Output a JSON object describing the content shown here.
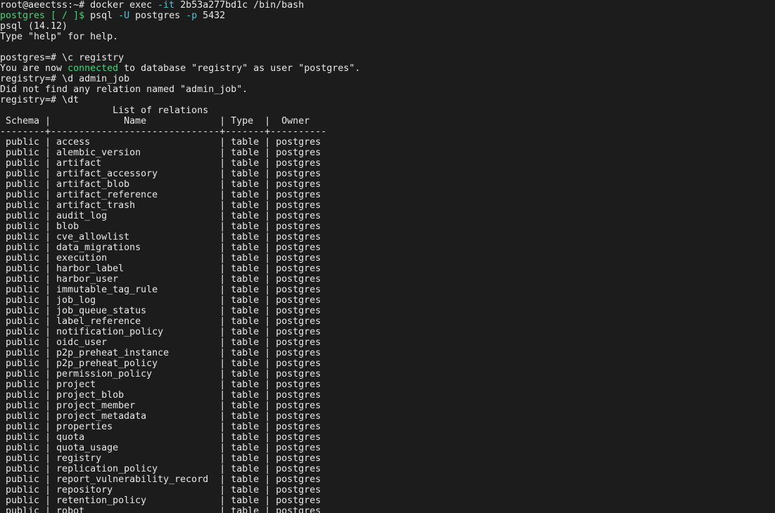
{
  "terminal": {
    "background_color": "#1c1c1c",
    "foreground_color": "#e8e8e8",
    "green_color": "#3fd67a",
    "cyan_color": "#4fc3d9",
    "shell_prompt_host": "root@aeectss:~#",
    "docker_prompt": "postgres [ / ]$",
    "psql_prompt_postgres": "postgres=#",
    "psql_prompt_registry": "registry=#"
  },
  "session": {
    "line_01_prompt": "root@aeectss:~# docker exec ",
    "line_01_flag": "-it",
    "line_01_rest": " 2b53a277bd1c /bin/bash",
    "line_02_prompt": "postgres [ / ]$",
    "line_02_cmd": " psql ",
    "line_02_flag_u": "-U",
    "line_02_user": " postgres ",
    "line_02_flag_p": "-p",
    "line_02_port": " 5432",
    "line_03": "psql (14.12)",
    "line_04": "Type \"help\" for help.",
    "line_05": "",
    "line_06": "postgres=# \\c registry",
    "line_07_a": "You are now ",
    "line_07_b": "connected",
    "line_07_c": " to database \"registry\" as user \"postgres\".",
    "line_08": "registry=# \\d admin_job",
    "line_09": "Did not find any relation named \"admin_job\".",
    "line_10": "registry=# \\dt"
  },
  "relations_table": {
    "title": "List of relations",
    "title_indent": 20,
    "header": " Schema |             Name             | Type  |  Owner   ",
    "separator": "--------+------------------------------+-------+----------",
    "columns": [
      "Schema",
      "Name",
      "Type",
      "Owner"
    ],
    "rows": [
      {
        "schema": "public",
        "name": "access",
        "type": "table",
        "owner": "postgres"
      },
      {
        "schema": "public",
        "name": "alembic_version",
        "type": "table",
        "owner": "postgres"
      },
      {
        "schema": "public",
        "name": "artifact",
        "type": "table",
        "owner": "postgres"
      },
      {
        "schema": "public",
        "name": "artifact_accessory",
        "type": "table",
        "owner": "postgres"
      },
      {
        "schema": "public",
        "name": "artifact_blob",
        "type": "table",
        "owner": "postgres"
      },
      {
        "schema": "public",
        "name": "artifact_reference",
        "type": "table",
        "owner": "postgres"
      },
      {
        "schema": "public",
        "name": "artifact_trash",
        "type": "table",
        "owner": "postgres"
      },
      {
        "schema": "public",
        "name": "audit_log",
        "type": "table",
        "owner": "postgres"
      },
      {
        "schema": "public",
        "name": "blob",
        "type": "table",
        "owner": "postgres"
      },
      {
        "schema": "public",
        "name": "cve_allowlist",
        "type": "table",
        "owner": "postgres"
      },
      {
        "schema": "public",
        "name": "data_migrations",
        "type": "table",
        "owner": "postgres"
      },
      {
        "schema": "public",
        "name": "execution",
        "type": "table",
        "owner": "postgres"
      },
      {
        "schema": "public",
        "name": "harbor_label",
        "type": "table",
        "owner": "postgres"
      },
      {
        "schema": "public",
        "name": "harbor_user",
        "type": "table",
        "owner": "postgres"
      },
      {
        "schema": "public",
        "name": "immutable_tag_rule",
        "type": "table",
        "owner": "postgres"
      },
      {
        "schema": "public",
        "name": "job_log",
        "type": "table",
        "owner": "postgres"
      },
      {
        "schema": "public",
        "name": "job_queue_status",
        "type": "table",
        "owner": "postgres"
      },
      {
        "schema": "public",
        "name": "label_reference",
        "type": "table",
        "owner": "postgres"
      },
      {
        "schema": "public",
        "name": "notification_policy",
        "type": "table",
        "owner": "postgres"
      },
      {
        "schema": "public",
        "name": "oidc_user",
        "type": "table",
        "owner": "postgres"
      },
      {
        "schema": "public",
        "name": "p2p_preheat_instance",
        "type": "table",
        "owner": "postgres"
      },
      {
        "schema": "public",
        "name": "p2p_preheat_policy",
        "type": "table",
        "owner": "postgres"
      },
      {
        "schema": "public",
        "name": "permission_policy",
        "type": "table",
        "owner": "postgres"
      },
      {
        "schema": "public",
        "name": "project",
        "type": "table",
        "owner": "postgres"
      },
      {
        "schema": "public",
        "name": "project_blob",
        "type": "table",
        "owner": "postgres"
      },
      {
        "schema": "public",
        "name": "project_member",
        "type": "table",
        "owner": "postgres"
      },
      {
        "schema": "public",
        "name": "project_metadata",
        "type": "table",
        "owner": "postgres"
      },
      {
        "schema": "public",
        "name": "properties",
        "type": "table",
        "owner": "postgres"
      },
      {
        "schema": "public",
        "name": "quota",
        "type": "table",
        "owner": "postgres"
      },
      {
        "schema": "public",
        "name": "quota_usage",
        "type": "table",
        "owner": "postgres"
      },
      {
        "schema": "public",
        "name": "registry",
        "type": "table",
        "owner": "postgres"
      },
      {
        "schema": "public",
        "name": "replication_policy",
        "type": "table",
        "owner": "postgres"
      },
      {
        "schema": "public",
        "name": "report_vulnerability_record",
        "type": "table",
        "owner": "postgres"
      },
      {
        "schema": "public",
        "name": "repository",
        "type": "table",
        "owner": "postgres"
      },
      {
        "schema": "public",
        "name": "retention_policy",
        "type": "table",
        "owner": "postgres"
      },
      {
        "schema": "public",
        "name": "robot",
        "type": "table",
        "owner": "postgres"
      }
    ]
  }
}
